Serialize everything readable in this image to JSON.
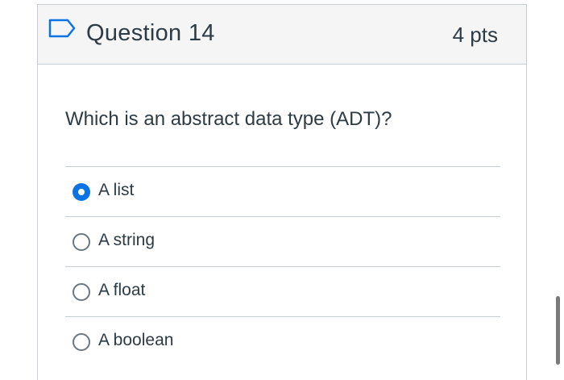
{
  "question": {
    "title": "Question 14",
    "points": "4 pts",
    "text": "Which is an abstract data type (ADT)?",
    "icon": "flag-outline-icon"
  },
  "answers": [
    {
      "label": "A list",
      "selected": true
    },
    {
      "label": "A string",
      "selected": false
    },
    {
      "label": "A float",
      "selected": false
    },
    {
      "label": "A boolean",
      "selected": false
    }
  ],
  "colors": {
    "accent": "#0b74e5",
    "text": "#2d3b45",
    "border": "#c7cdd1",
    "header_bg": "#f5f5f5"
  }
}
